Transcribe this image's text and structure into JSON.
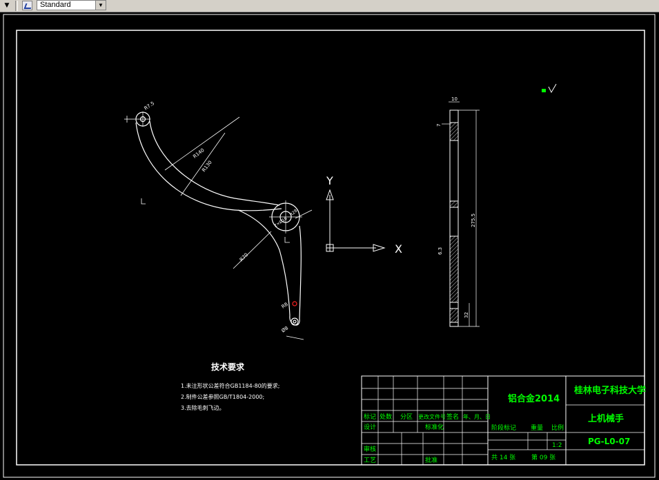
{
  "toolbar": {
    "style_dropdown_value": "Standard"
  },
  "drawing": {
    "view_labels": {
      "r_small_top": "R7.5",
      "r_large_outer": "R140",
      "r_large_inner": "R130",
      "r_lower_arc": "R70",
      "r_hub": "R28",
      "hub_hole": "2×Ø16",
      "r_bottom": "R8",
      "hole_bottom": "Ø8"
    },
    "ucs": {
      "y_label": "Y",
      "x_label": "X"
    },
    "side_view": {
      "dim_top": "10",
      "dim_small": "7",
      "dim_height": "275.5",
      "dim_bottom": "32",
      "surface_finish_side": "6.3"
    },
    "tech_req": {
      "heading": "技术要求",
      "lines": [
        "1.未注形状公差符合GB1184-80的要求;",
        "2.制件公差参照GB/T1804-2000;",
        "3.去除毛刺飞边。"
      ]
    },
    "title_block": {
      "material": "铝合金2014",
      "school": "桂林电子科技大学",
      "part_name": "上机械手",
      "drawing_no": "PG-L0-07",
      "header_row": [
        "标记",
        "处数",
        "分区",
        "更改文件号",
        "签名",
        "年、月、日"
      ],
      "design": "设计",
      "standardize": "标准化",
      "review": "审核",
      "process": "工艺",
      "approve": "批准",
      "stage_label": "阶段标记",
      "weight_label": "重量",
      "scale_label": "比例",
      "scale_value": "1:2",
      "total_sheets": "共 14 张",
      "sheet_no": "第 09 张"
    }
  },
  "colors": {
    "line": "#ffffff",
    "text_green": "#00ff00",
    "text_yellow": "#ffff00",
    "dim_red": "#ff2020",
    "toolbar_bg": "#d4d0c8"
  }
}
